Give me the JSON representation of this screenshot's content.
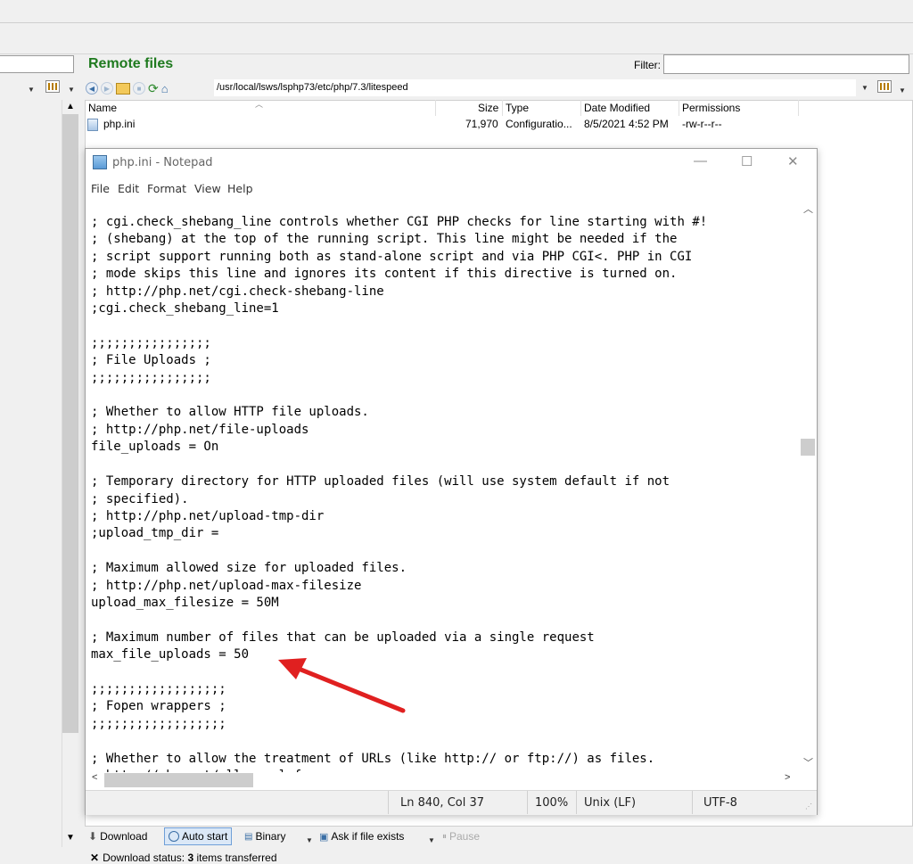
{
  "remote": {
    "title": "Remote files",
    "filter_label": "Filter:",
    "filter_value": "",
    "path": "/usr/local/lsws/lsphp73/etc/php/7.3/litespeed"
  },
  "file_list": {
    "columns": [
      "Name",
      "Size",
      "Type",
      "Date Modified",
      "Permissions"
    ],
    "rows": [
      {
        "name": "php.ini",
        "size": "71,970",
        "type": "Configuratio...",
        "date": "8/5/2021 4:52 PM",
        "permissions": "-rw-r--r--"
      }
    ]
  },
  "notepad": {
    "title": "php.ini - Notepad",
    "menu": [
      "File",
      "Edit",
      "Format",
      "View",
      "Help"
    ],
    "content": "; cgi.check_shebang_line controls whether CGI PHP checks for line starting with #!\n; (shebang) at the top of the running script. This line might be needed if the\n; script support running both as stand-alone script and via PHP CGI<. PHP in CGI\n; mode skips this line and ignores its content if this directive is turned on.\n; http://php.net/cgi.check-shebang-line\n;cgi.check_shebang_line=1\n\n;;;;;;;;;;;;;;;;\n; File Uploads ;\n;;;;;;;;;;;;;;;;\n\n; Whether to allow HTTP file uploads.\n; http://php.net/file-uploads\nfile_uploads = On\n\n; Temporary directory for HTTP uploaded files (will use system default if not\n; specified).\n; http://php.net/upload-tmp-dir\n;upload_tmp_dir =\n\n; Maximum allowed size for uploaded files.\n; http://php.net/upload-max-filesize\nupload_max_filesize = 50M\n\n; Maximum number of files that can be uploaded via a single request\nmax_file_uploads = 50\n\n;;;;;;;;;;;;;;;;;;\n; Fopen wrappers ;\n;;;;;;;;;;;;;;;;;;\n\n; Whether to allow the treatment of URLs (like http:// or ftp://) as files.\n; http://php.net/allow-url-fopen",
    "status": {
      "position": "Ln 840, Col 37",
      "zoom": "100%",
      "line_ending": "Unix (LF)",
      "encoding": "UTF-8"
    }
  },
  "bottom_toolbar": {
    "download": "Download",
    "auto_start": "Auto start",
    "binary": "Binary",
    "ask_if_exists": "Ask if file exists",
    "pause": "Pause"
  },
  "status_line": {
    "prefix": "Download status: ",
    "count": "3",
    "suffix": " items transferred"
  },
  "colors": {
    "remote_title": "#1f7a1f",
    "annotation_arrow": "#e02020"
  }
}
